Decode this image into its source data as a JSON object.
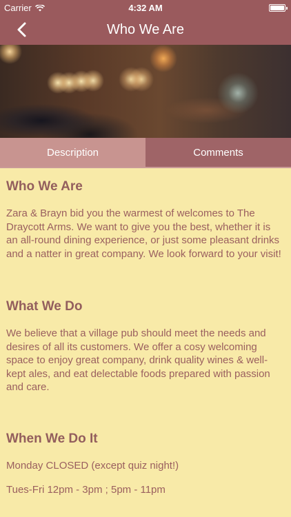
{
  "status": {
    "carrier": "Carrier",
    "time": "4:32 AM"
  },
  "nav": {
    "title": "Who We Are",
    "back_icon": "chevron-left-icon"
  },
  "tabs": [
    {
      "label": "Description",
      "active": true
    },
    {
      "label": "Comments",
      "active": false
    }
  ],
  "sections": [
    {
      "heading": "Who We Are",
      "text": "Zara & Brayn bid you the warmest of welcomes to The Draycott Arms. We want to give you the best, whether it is an all-round dining experience, or just some pleasant drinks and a natter in great company. We look forward to your visit!"
    },
    {
      "heading": "What We Do",
      "text": "We believe that a village pub should meet the needs and desires of all its customers. We offer a cosy welcoming space to enjoy great company, drink quality wines & well-kept ales, and eat delectable foods prepared with passion and care."
    },
    {
      "heading": "When We Do It",
      "lines": [
        "Monday CLOSED (except quiz night!)",
        "Tues-Fri  12pm - 3pm ; 5pm - 11pm"
      ]
    }
  ],
  "colors": {
    "header": "#9a5a5d",
    "tab_active": "#c89490",
    "tab_inactive": "#9f6467",
    "background": "#f8eaa8",
    "text": "#9a5f5f"
  }
}
